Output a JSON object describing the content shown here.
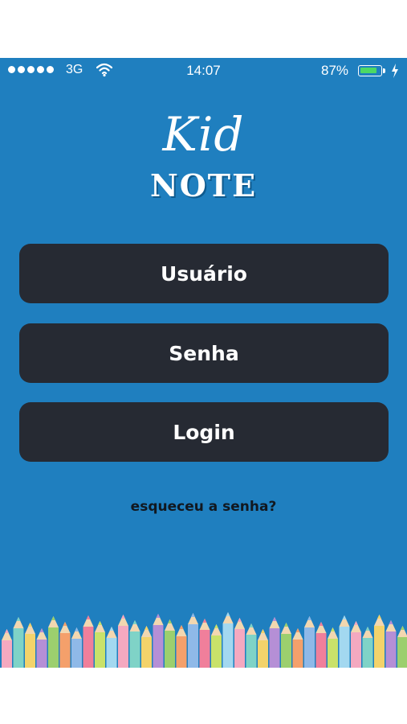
{
  "status_bar": {
    "carrier": "3G",
    "time": "14:07",
    "battery_percent": "87%",
    "battery_level": 0.87,
    "signal_icon": "signal-dots-icon",
    "wifi_icon": "wifi-icon",
    "charging_icon": "bolt-icon"
  },
  "logo": {
    "line1": "Kid",
    "line2": "NOTE"
  },
  "form": {
    "username_placeholder": "Usuário",
    "password_placeholder": "Senha",
    "login_label": "Login",
    "forgot_link": "esqueceu a senha?"
  },
  "colors": {
    "background": "#1f7fbf",
    "button": "#262a33",
    "text_light": "#ffffff",
    "link": "#111820"
  }
}
